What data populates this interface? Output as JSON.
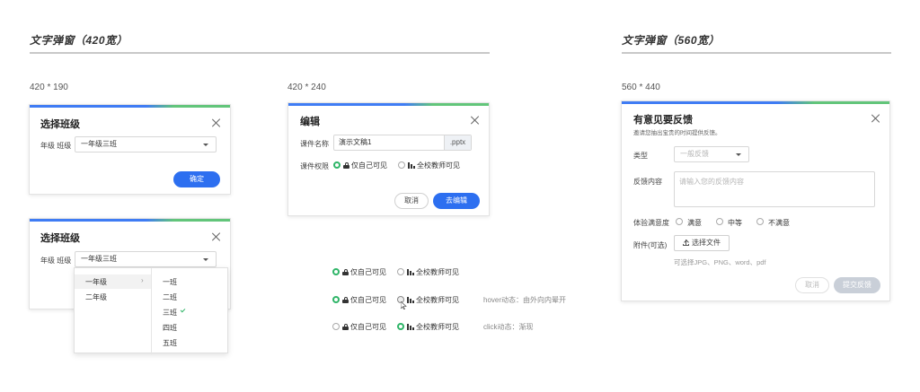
{
  "section_420": {
    "title": "文字弹窗（420宽）"
  },
  "section_560": {
    "title": "文字弹窗（560宽）"
  },
  "size_labels": {
    "a": "420 * 190",
    "b": "420 * 240",
    "c": "560 * 440"
  },
  "dialog1": {
    "title": "选择班级",
    "field_label": "年级 班级",
    "select_value": "一年级三班",
    "confirm": "确定"
  },
  "dialog2": {
    "title": "选择班级",
    "field_label": "年级 班级",
    "select_value": "一年级三班",
    "grades": [
      "一年级",
      "二年级"
    ],
    "classes": [
      "一班",
      "二班",
      "三班",
      "四班",
      "五班"
    ]
  },
  "dialog_edit": {
    "title": "编辑",
    "name_label": "课件名称",
    "name_value": "演示文稿1",
    "suffix": ".pptx",
    "perm_label": "课件权限",
    "opt_self": "仅自己可见",
    "opt_all": "全校教师可见",
    "cancel": "取消",
    "submit": "去编辑"
  },
  "radio_states": {
    "self": "仅自己可见",
    "all": "全校教师可见",
    "hover_note": "hover动态：由外向内晕开",
    "click_note": "click动态：渐现"
  },
  "feedback": {
    "title": "有意见要反馈",
    "subtitle": "邀请您抽出宝贵的时间提供反馈。",
    "type_label": "类型",
    "type_placeholder": "一般反馈",
    "content_label": "反馈内容",
    "content_placeholder": "请输入您的反馈内容",
    "rating_label": "体验满意度",
    "ratings": [
      "满意",
      "中等",
      "不满意"
    ],
    "attach_label": "附件(可选)",
    "upload_button": "选择文件",
    "hint": "可选择JPG、PNG、word、pdf",
    "cancel": "取消",
    "submit": "提交反馈"
  },
  "colors": {
    "primary": "#2d6ff0",
    "green": "#2fb568",
    "accent_blue": "#3f7cf4",
    "accent_green": "#62c57a"
  }
}
